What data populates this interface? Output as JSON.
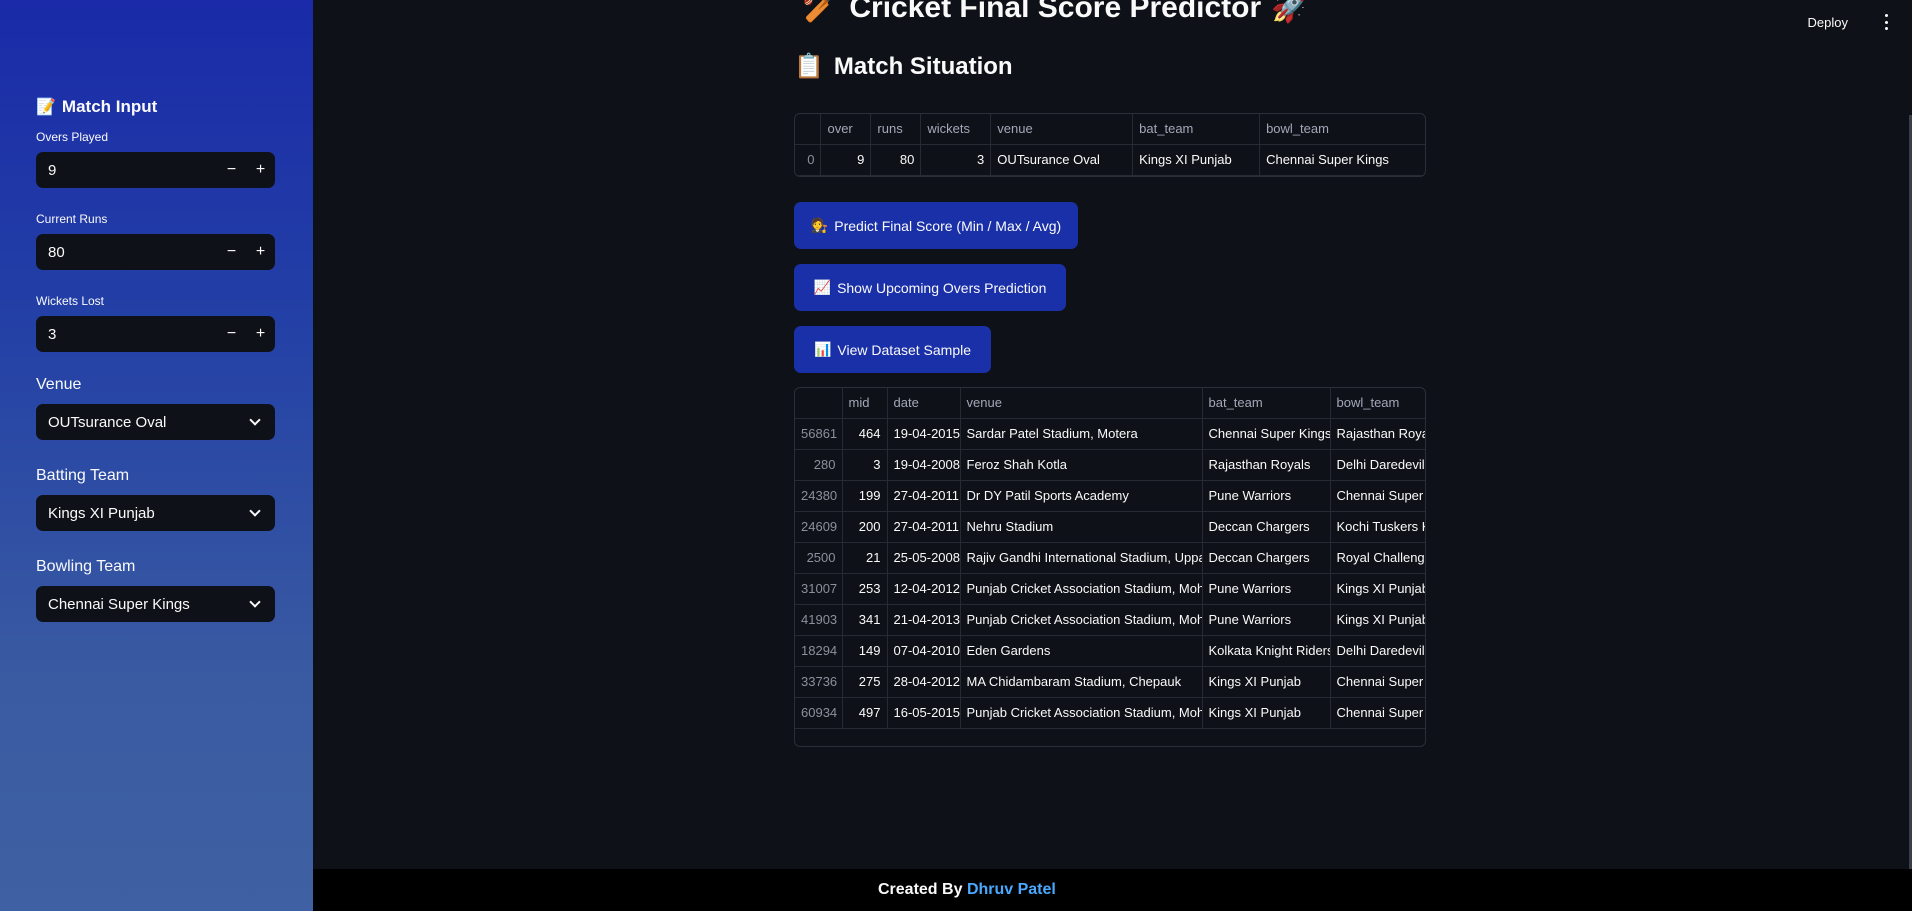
{
  "sidebar": {
    "title": "Match Input",
    "title_icon": "📝",
    "overs_label": "Overs Played",
    "overs_value": "9",
    "runs_label": "Current Runs",
    "runs_value": "80",
    "wickets_label": "Wickets Lost",
    "wickets_value": "3",
    "venue_label": "Venue",
    "venue_value": "OUTsurance Oval",
    "batting_label": "Batting Team",
    "batting_value": "Kings XI Punjab",
    "bowling_label": "Bowling Team",
    "bowling_value": "Chennai Super Kings",
    "minus": "−",
    "plus": "+"
  },
  "header": {
    "deploy": "Deploy",
    "title_icon_left": "🏏",
    "title": "Cricket Final Score Predictor",
    "title_icon_right": "🚀"
  },
  "situation": {
    "icon": "📋",
    "title": "Match Situation",
    "columns": [
      "",
      "over",
      "runs",
      "wickets",
      "venue",
      "bat_team",
      "bowl_team"
    ],
    "row": [
      "0",
      "9",
      "80",
      "3",
      "OUTsurance Oval",
      "Kings XI Punjab",
      "Chennai Super Kings"
    ]
  },
  "buttons": {
    "predict_icon": "🧑‍⚖️",
    "predict": "Predict Final Score (Min / Max / Avg)",
    "upcoming_icon": "📈",
    "upcoming": "Show Upcoming Overs Prediction",
    "dataset_icon": "📊",
    "dataset": "View Dataset Sample"
  },
  "dataset": {
    "columns": [
      "",
      "mid",
      "date",
      "venue",
      "bat_team",
      "bowl_team"
    ],
    "rows": [
      [
        "56861",
        "464",
        "19-04-2015",
        "Sardar Patel Stadium, Motera",
        "Chennai Super Kings",
        "Rajasthan Royals"
      ],
      [
        "280",
        "3",
        "19-04-2008",
        "Feroz Shah Kotla",
        "Rajasthan Royals",
        "Delhi Daredevils"
      ],
      [
        "24380",
        "199",
        "27-04-2011",
        "Dr DY Patil Sports Academy",
        "Pune Warriors",
        "Chennai Super Kings"
      ],
      [
        "24609",
        "200",
        "27-04-2011",
        "Nehru Stadium",
        "Deccan Chargers",
        "Kochi Tuskers Kerala"
      ],
      [
        "2500",
        "21",
        "25-05-2008",
        "Rajiv Gandhi International Stadium, Uppal",
        "Deccan Chargers",
        "Royal Challengers Bangalore"
      ],
      [
        "31007",
        "253",
        "12-04-2012",
        "Punjab Cricket Association Stadium, Mohali",
        "Pune Warriors",
        "Kings XI Punjab"
      ],
      [
        "41903",
        "341",
        "21-04-2013",
        "Punjab Cricket Association Stadium, Mohali",
        "Pune Warriors",
        "Kings XI Punjab"
      ],
      [
        "18294",
        "149",
        "07-04-2010",
        "Eden Gardens",
        "Kolkata Knight Riders",
        "Delhi Daredevils"
      ],
      [
        "33736",
        "275",
        "28-04-2012",
        "MA Chidambaram Stadium, Chepauk",
        "Kings XI Punjab",
        "Chennai Super Kings"
      ],
      [
        "60934",
        "497",
        "16-05-2015",
        "Punjab Cricket Association Stadium, Mohali",
        "Kings XI Punjab",
        "Chennai Super Kings"
      ]
    ]
  },
  "footer": {
    "prefix": "Created By",
    "author": "Dhruv Patel"
  }
}
